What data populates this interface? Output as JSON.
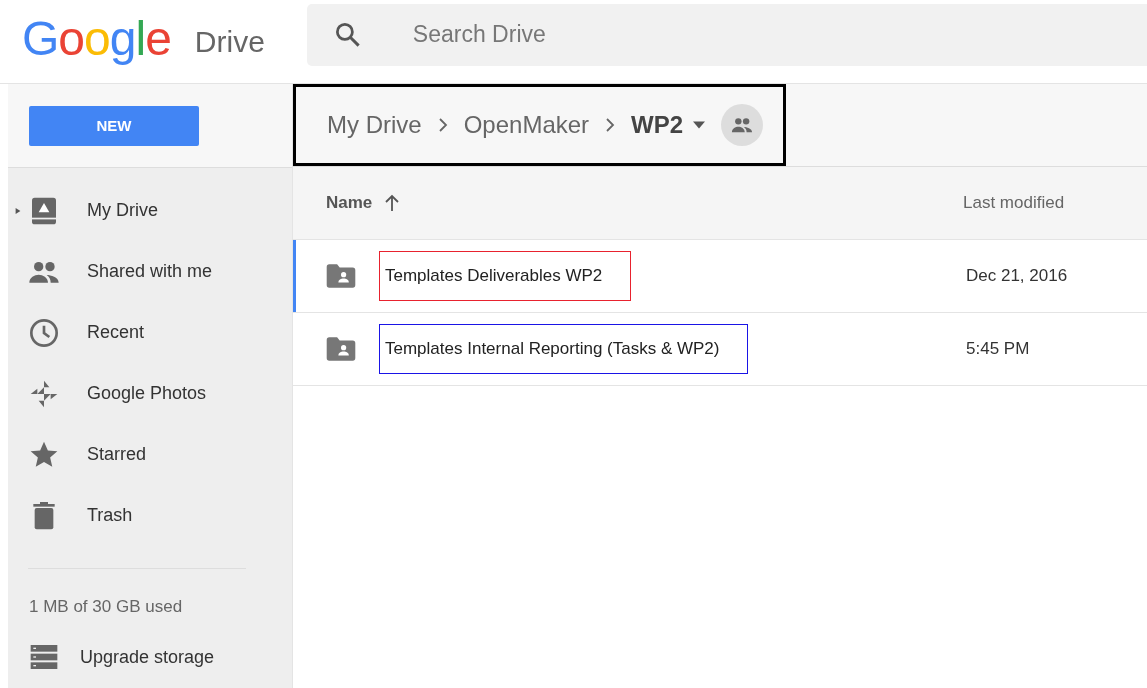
{
  "header": {
    "logo": "Google",
    "product": "Drive",
    "search": {
      "placeholder": "Search Drive"
    }
  },
  "new_button": "NEW",
  "breadcrumb": {
    "items": [
      "My Drive",
      "OpenMaker",
      "WP2"
    ],
    "color": "#000000"
  },
  "sidebar": {
    "items": [
      {
        "label": "My Drive",
        "kind": "drive",
        "expanded": false
      },
      {
        "label": "Shared with me",
        "kind": "people"
      },
      {
        "label": "Recent",
        "kind": "clock"
      },
      {
        "label": "Google Photos",
        "kind": "pinwheel"
      },
      {
        "label": "Starred",
        "kind": "star"
      },
      {
        "label": "Trash",
        "kind": "trash"
      }
    ],
    "storage": "1 MB of 30 GB used",
    "upgrade": "Upgrade storage"
  },
  "table": {
    "columns": [
      {
        "label": "Name",
        "sorted_ascending": true
      },
      {
        "label": "Last modified"
      }
    ],
    "rows": [
      {
        "name": "Templates Deliverables WP2",
        "modified": "Dec 21, 2016",
        "selected": true,
        "color": "#e8222e"
      },
      {
        "name": "Templates Internal Reporting (Tasks & WP2)",
        "modified": "5:45 PM",
        "selected": false,
        "color": "#1a14e6"
      }
    ]
  }
}
